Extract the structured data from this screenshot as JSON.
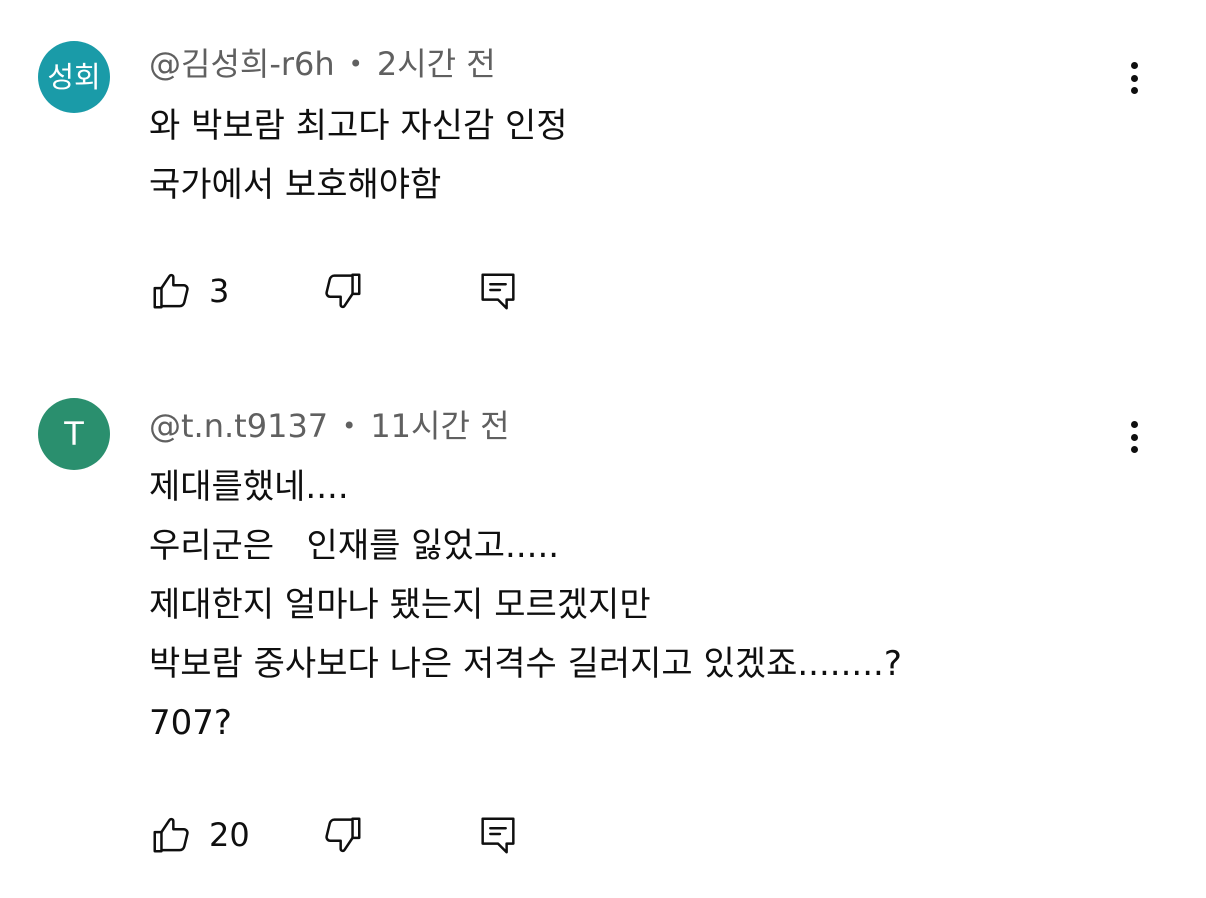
{
  "colors": {
    "avatar_1": "#1a9ba8",
    "avatar_2": "#2a8f6e",
    "meta_text": "#606060",
    "body_text": "#0f0f0f"
  },
  "comments": [
    {
      "avatar_text": "성회",
      "author": "@김성희-r6h",
      "separator": "•",
      "time": "2시간 전",
      "lines": [
        "와 박보람 최고다 자신감 인정",
        "국가에서 보호해야함"
      ],
      "like_count": "3",
      "icons": {
        "like": "thumbs-up-icon",
        "dislike": "thumbs-down-icon",
        "reply": "reply-icon",
        "more": "more-vert-icon"
      }
    },
    {
      "avatar_text": "T",
      "author": "@t.n.t9137",
      "separator": "•",
      "time": "11시간 전",
      "lines": [
        "제대를했네....",
        "우리군은   인재를 잃었고.....",
        "제대한지 얼마나 됐는지 모르겠지만",
        "박보람 중사보다 나은 저격수 길러지고 있겠죠........?",
        "707?"
      ],
      "like_count": "20",
      "icons": {
        "like": "thumbs-up-icon",
        "dislike": "thumbs-down-icon",
        "reply": "reply-icon",
        "more": "more-vert-icon"
      }
    }
  ]
}
